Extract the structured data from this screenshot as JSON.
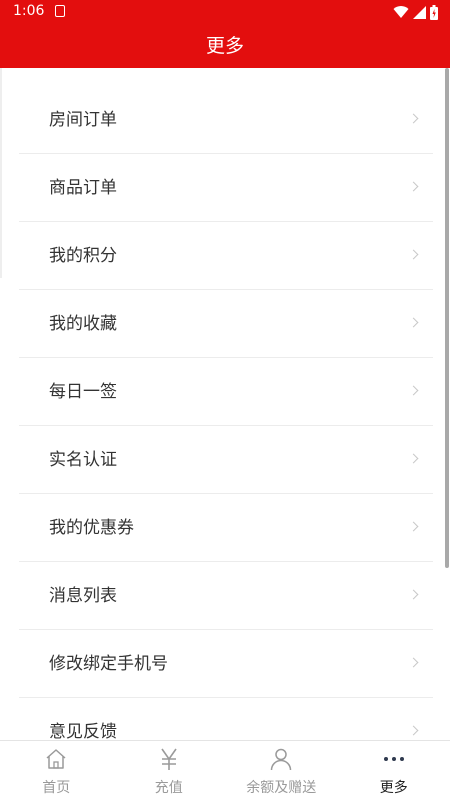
{
  "status_bar": {
    "time": "1:06"
  },
  "header": {
    "title": "更多"
  },
  "menu": {
    "items": [
      {
        "label": "房间订单"
      },
      {
        "label": "商品订单"
      },
      {
        "label": "我的积分"
      },
      {
        "label": "我的收藏"
      },
      {
        "label": "每日一签"
      },
      {
        "label": "实名认证"
      },
      {
        "label": "我的优惠券"
      },
      {
        "label": "消息列表"
      },
      {
        "label": "修改绑定手机号"
      },
      {
        "label": "意见反馈"
      }
    ]
  },
  "tab_bar": {
    "tabs": [
      {
        "label": "首页",
        "icon": "home-icon"
      },
      {
        "label": "充值",
        "icon": "yen-icon"
      },
      {
        "label": "余额及赠送",
        "icon": "person-icon"
      },
      {
        "label": "更多",
        "icon": "more-icon"
      }
    ],
    "active_index": 3
  },
  "colors": {
    "brand": "#e30e0e",
    "text": "#333333",
    "tab_inactive": "#9a9a9a",
    "tab_active": "#222222"
  }
}
